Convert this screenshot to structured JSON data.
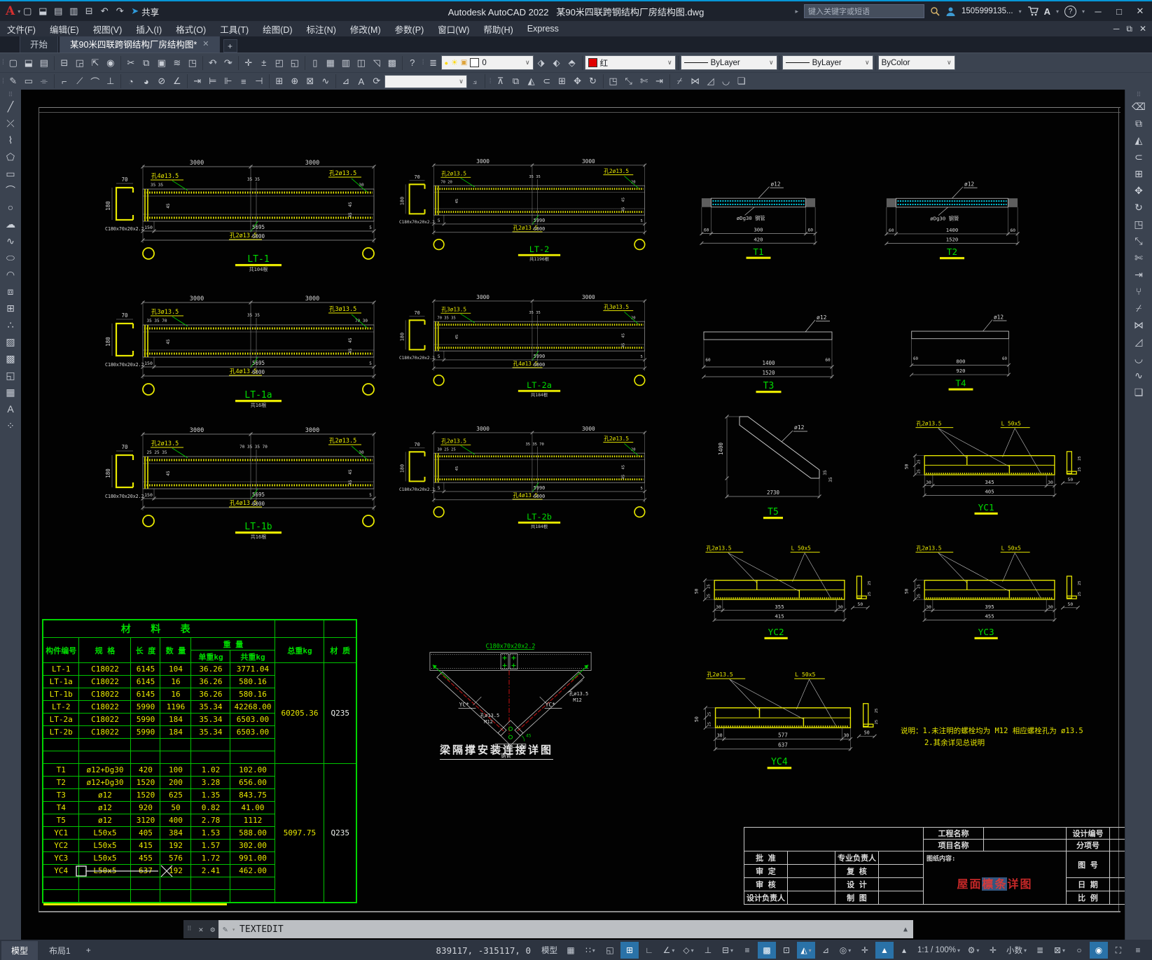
{
  "window": {
    "logo": "A",
    "app_title": "Autodesk AutoCAD 2022",
    "doc_title": "某90米四联跨钢结构厂房结构图.dwg",
    "share": "共享",
    "search_placeholder": "键入关键字或短语",
    "user": "1505999135..."
  },
  "menu": [
    "文件(F)",
    "编辑(E)",
    "视图(V)",
    "插入(I)",
    "格式(O)",
    "工具(T)",
    "绘图(D)",
    "标注(N)",
    "修改(M)",
    "参数(P)",
    "窗口(W)",
    "帮助(H)",
    "Express"
  ],
  "tabs": {
    "start": "开始",
    "document": "某90米四联跨钢结构厂房结构图*"
  },
  "controls": {
    "layer_value": "0",
    "color_value": "红",
    "linetype_value": "ByLayer",
    "lineweight_value": "ByLayer",
    "plotstyle_value": "ByColor"
  },
  "command": {
    "label": "TEXTEDIT"
  },
  "layout_tabs": {
    "model": "模型",
    "layout1": "布局1"
  },
  "statusbar": {
    "coords": "839117, -315117, 0",
    "model_space": "模型",
    "scale": "1:1 / 100%",
    "units": "小数"
  },
  "colors": {
    "accent_blue": "#0696d7",
    "cad_yellow": "#e8e800",
    "cad_green": "#00d800",
    "cad_cyan": "#00e5ff",
    "cad_red": "#cc2222",
    "table_green": "#00c400"
  },
  "qat_icons": [
    {
      "n": "new-file-icon",
      "g": "▢"
    },
    {
      "n": "open-file-icon",
      "g": "⬓"
    },
    {
      "n": "save-icon",
      "g": "▤"
    },
    {
      "n": "save-as-icon",
      "g": "▥"
    },
    {
      "n": "plot-icon",
      "g": "⊟"
    },
    {
      "n": "undo-icon",
      "g": "↶"
    },
    {
      "n": "redo-icon",
      "g": "↷"
    }
  ],
  "std_toolbar": [
    {
      "n": "new-icon",
      "g": "▢"
    },
    {
      "n": "open-icon",
      "g": "⬓"
    },
    {
      "n": "save-icon",
      "g": "▤"
    },
    {
      "n": "sep"
    },
    {
      "n": "plot-icon",
      "g": "⊟"
    },
    {
      "n": "plot-preview-icon",
      "g": "◲"
    },
    {
      "n": "publish-icon",
      "g": "⇱"
    },
    {
      "n": "batch-plot-icon",
      "g": "◉"
    },
    {
      "n": "sep"
    },
    {
      "n": "cut-icon",
      "g": "✂"
    },
    {
      "n": "copy-clip-icon",
      "g": "⧉"
    },
    {
      "n": "paste-icon",
      "g": "▣"
    },
    {
      "n": "match-properties-icon",
      "g": "≋"
    },
    {
      "n": "block-editor-icon",
      "g": "◳"
    },
    {
      "n": "sep"
    },
    {
      "n": "undo-icon",
      "g": "↶",
      "c": 1
    },
    {
      "n": "redo-icon",
      "g": "↷",
      "c": 1
    },
    {
      "n": "sep"
    },
    {
      "n": "pan-icon",
      "g": "✛"
    },
    {
      "n": "zoom-realtime-icon",
      "g": "±"
    },
    {
      "n": "zoom-window-icon",
      "g": "◰"
    },
    {
      "n": "zoom-previous-icon",
      "g": "◱"
    },
    {
      "n": "sep"
    },
    {
      "n": "properties-icon",
      "g": "▯"
    },
    {
      "n": "designcenter-icon",
      "g": "▦"
    },
    {
      "n": "toolpalettes-icon",
      "g": "▥"
    },
    {
      "n": "sheetset-icon",
      "g": "◫"
    },
    {
      "n": "markup-icon",
      "g": "◹"
    },
    {
      "n": "qcalc-icon",
      "g": "▩"
    },
    {
      "n": "sep"
    },
    {
      "n": "help-icon",
      "g": "?"
    }
  ],
  "layer_toolbar": {
    "props_icon": "≣",
    "bulb": "●",
    "sun": "☀",
    "lock": "▣",
    "swatch": "□"
  },
  "layer_states": [
    {
      "n": "layer-previous-icon",
      "g": "⬗"
    },
    {
      "n": "layer-state-icon",
      "g": "⬖"
    },
    {
      "n": "layer-isolate-icon",
      "g": "⬘"
    }
  ],
  "dim_toolbar": [
    {
      "n": "textedit-icon",
      "g": "✎"
    },
    {
      "n": "mtext-edit-icon",
      "g": "▭"
    },
    {
      "n": "spellcheck-icon",
      "g": "⌯"
    },
    {
      "n": "sep"
    },
    {
      "n": "linear-dimension-icon",
      "g": "⌐"
    },
    {
      "n": "aligned-dimension-icon",
      "g": "⟋"
    },
    {
      "n": "arc-length-icon",
      "g": "⌒"
    },
    {
      "n": "ordinate-icon",
      "g": "⊥"
    },
    {
      "n": "sep"
    },
    {
      "n": "radius-icon",
      "g": "◔"
    },
    {
      "n": "jogged-icon",
      "g": "◕"
    },
    {
      "n": "diameter-icon",
      "g": "⊘"
    },
    {
      "n": "angular-icon",
      "g": "∠"
    },
    {
      "n": "sep"
    },
    {
      "n": "quick-dim-icon",
      "g": "⇥"
    },
    {
      "n": "baseline-icon",
      "g": "⊨"
    },
    {
      "n": "continue-icon",
      "g": "⊩"
    },
    {
      "n": "dim-space-icon",
      "g": "≡"
    },
    {
      "n": "dim-break-icon",
      "g": "⊣"
    },
    {
      "n": "sep"
    },
    {
      "n": "tolerance-icon",
      "g": "⊞"
    },
    {
      "n": "center-mark-icon",
      "g": "⊕"
    },
    {
      "n": "inspect-icon",
      "g": "⊠"
    },
    {
      "n": "jog-line-icon",
      "g": "∿"
    },
    {
      "n": "sep"
    },
    {
      "n": "dim-edit-icon",
      "g": "⊿"
    },
    {
      "n": "dim-text-edit-icon",
      "g": "A"
    },
    {
      "n": "dim-update-icon",
      "g": "⟳"
    }
  ],
  "modify2_toolbar": [
    {
      "n": "draworder-icon",
      "g": "⊼"
    },
    {
      "n": "copy-icon",
      "g": "⧉"
    },
    {
      "n": "mirror-icon",
      "g": "◭"
    },
    {
      "n": "offset-icon",
      "g": "⊂"
    },
    {
      "n": "array-icon",
      "g": "⊞"
    },
    {
      "n": "move-icon",
      "g": "✥"
    },
    {
      "n": "rotate-icon",
      "g": "↻"
    },
    {
      "n": "sep"
    },
    {
      "n": "scale-icon",
      "g": "◳"
    },
    {
      "n": "stretch-icon",
      "g": "⤡"
    },
    {
      "n": "trim-icon",
      "g": "✄"
    },
    {
      "n": "extend-icon",
      "g": "⇥"
    },
    {
      "n": "sep"
    },
    {
      "n": "break-icon",
      "g": "⌿"
    },
    {
      "n": "join-icon",
      "g": "⋈"
    },
    {
      "n": "chamfer-icon",
      "g": "◿"
    },
    {
      "n": "fillet-icon",
      "g": "◡"
    },
    {
      "n": "explode-icon",
      "g": "❏"
    }
  ],
  "draw_toolbar": [
    {
      "n": "line-icon",
      "g": "╱"
    },
    {
      "n": "xline-icon",
      "g": "⤫"
    },
    {
      "n": "polyline-icon",
      "g": "⌇"
    },
    {
      "n": "polygon-icon",
      "g": "⬠"
    },
    {
      "n": "rectangle-icon",
      "g": "▭"
    },
    {
      "n": "arc-icon",
      "g": "⌒"
    },
    {
      "n": "circle-icon",
      "g": "○"
    },
    {
      "n": "revcloud-icon",
      "g": "☁"
    },
    {
      "n": "spline-icon",
      "g": "∿"
    },
    {
      "n": "ellipse-icon",
      "g": "⬭"
    },
    {
      "n": "ellipse-arc-icon",
      "g": "◠"
    },
    {
      "n": "insert-block-icon",
      "g": "⧈"
    },
    {
      "n": "make-block-icon",
      "g": "⊞"
    },
    {
      "n": "point-icon",
      "g": "∴"
    },
    {
      "n": "hatch-icon",
      "g": "▨"
    },
    {
      "n": "gradient-icon",
      "g": "▩"
    },
    {
      "n": "region-icon",
      "g": "◱"
    },
    {
      "n": "table-icon",
      "g": "▦"
    },
    {
      "n": "mtext-icon",
      "g": "A"
    },
    {
      "n": "point-style-icon",
      "g": "⁘"
    }
  ],
  "modify_toolbar": [
    {
      "n": "erase-icon",
      "g": "⌫"
    },
    {
      "n": "copy-icon",
      "g": "⧉"
    },
    {
      "n": "mirror-icon",
      "g": "◭"
    },
    {
      "n": "offset-icon",
      "g": "⊂"
    },
    {
      "n": "array-icon",
      "g": "⊞"
    },
    {
      "n": "move-icon",
      "g": "✥"
    },
    {
      "n": "rotate-icon",
      "g": "↻"
    },
    {
      "n": "scale-icon",
      "g": "◳"
    },
    {
      "n": "stretch-icon",
      "g": "⤡"
    },
    {
      "n": "trim-icon",
      "g": "✄"
    },
    {
      "n": "extend-icon",
      "g": "⇥"
    },
    {
      "n": "break-at-point-icon",
      "g": "⑂"
    },
    {
      "n": "break-icon",
      "g": "⌿"
    },
    {
      "n": "join-icon",
      "g": "⋈"
    },
    {
      "n": "chamfer-icon",
      "g": "◿"
    },
    {
      "n": "fillet-icon",
      "g": "◡"
    },
    {
      "n": "blend-icon",
      "g": "∿"
    },
    {
      "n": "explode-icon",
      "g": "❏"
    }
  ],
  "status_items": [
    {
      "n": "grid",
      "g": "▦"
    },
    {
      "n": "snap-mode",
      "g": "∷",
      "c": 1
    },
    {
      "n": "infer-constraints",
      "g": "◱"
    },
    {
      "n": "dynamic-input",
      "g": "⊞",
      "a": 1
    },
    {
      "n": "ortho-mode",
      "g": "∟"
    },
    {
      "n": "polar-tracking",
      "g": "∠",
      "c": 1
    },
    {
      "n": "isometric-drafting",
      "g": "◇",
      "c": 1
    },
    {
      "n": "osnap-tracking",
      "g": "⊥"
    },
    {
      "n": "object-snap",
      "g": "⊟",
      "c": 1
    },
    {
      "n": "lineweight-display",
      "g": "≡"
    },
    {
      "n": "transparency",
      "g": "▩",
      "a": 1
    },
    {
      "n": "selection-cycling",
      "g": "⊡"
    },
    {
      "n": "osnap-3d",
      "g": "◭",
      "a": 1,
      "c": 1
    },
    {
      "n": "dynamic-ucs",
      "g": "⊿"
    },
    {
      "n": "selection-filtering",
      "g": "◎",
      "c": 1
    },
    {
      "n": "gizmo",
      "g": "✛"
    },
    {
      "n": "annotation-visibility",
      "g": "▲",
      "a": 1
    },
    {
      "n": "autoscale",
      "g": "▴"
    },
    {
      "n": "annotation-scale",
      "t": "1:1 / 100%",
      "c": 1
    },
    {
      "n": "workspace-switching",
      "g": "⚙",
      "c": 1
    },
    {
      "n": "annotation-monitor",
      "g": "✛"
    },
    {
      "n": "units",
      "t": "小数",
      "c": 1
    },
    {
      "n": "quick-properties",
      "g": "≣"
    },
    {
      "n": "lock-ui",
      "g": "⊠",
      "c": 1
    },
    {
      "n": "isolate-objects",
      "g": "○"
    },
    {
      "n": "graphics-performance",
      "g": "◉",
      "a": 1
    },
    {
      "n": "clean-screen",
      "g": "⛶"
    },
    {
      "n": "customization",
      "g": "≡"
    }
  ],
  "beams": [
    {
      "id": "LT-1",
      "count": "共104根",
      "dims_top": [
        "3000",
        "3000"
      ],
      "section": "C180x70x20x2.2",
      "sec_w": "70",
      "sec_h": "180",
      "hole_tl": "孔4ø13.5",
      "hole_bm": "孔2ø13.5",
      "hole_tr": "孔2ø13.5",
      "left_small": "35 35",
      "mid_small": "35 35",
      "right_small": "30",
      "dims_bottom": [
        "150",
        "5695",
        "5"
      ],
      "dim_total": "6000"
    },
    {
      "id": "LT-2",
      "count": "共1196根",
      "dims_top": [
        "3000",
        "3000"
      ],
      "section": "C180x70x20x2.2",
      "sec_w": "70",
      "sec_h": "180",
      "hole_tl": "孔2ø13.5",
      "hole_bm": "孔2ø13.5",
      "hole_tr": "孔2ø13.5",
      "left_small": "70 20",
      "mid_small": "35 35",
      "right_small": "20",
      "dims_bottom": [
        "5",
        "5990",
        "5"
      ],
      "dim_total": "6000"
    },
    {
      "id": "LT-1a",
      "count": "共16根",
      "dims_top": [
        "3000",
        "3000"
      ],
      "section": "C180x70x20x2.2",
      "sec_w": "70",
      "sec_h": "180",
      "hole_tl": "孔3ø13.5",
      "hole_bm": "孔4ø13.5",
      "hole_tr": "孔3ø13.5",
      "left_small": "35 35 70",
      "mid_small": "35 35",
      "right_small": "70 30",
      "dims_bottom": [
        "150",
        "5695",
        "5"
      ],
      "dim_total": "6000"
    },
    {
      "id": "LT-2a",
      "count": "共184根",
      "dims_top": [
        "3000",
        "3000"
      ],
      "section": "C180x70x20x2.2",
      "sec_w": "70",
      "sec_h": "180",
      "hole_tl": "孔3ø13.5",
      "hole_bm": "孔4ø13.5",
      "hole_tr": "孔3ø13.5",
      "left_small": "70 35 35",
      "mid_small": "35 35",
      "right_small": "20",
      "dims_bottom": [
        "5",
        "5990",
        "5"
      ],
      "dim_total": "6000"
    },
    {
      "id": "LT-1b",
      "count": "共16根",
      "dims_top": [
        "3000",
        "3000"
      ],
      "section": "C180x70x20x2.2",
      "sec_w": "70",
      "sec_h": "180",
      "hole_tl": "孔2ø13.5",
      "hole_bm": "孔4ø13.5",
      "hole_tr": "孔2ø13.5",
      "left_small": "25 25 35",
      "mid_small": "70 35 35 70",
      "right_small": "30",
      "dims_bottom": [
        "150",
        "5695",
        "5"
      ],
      "dim_total": "6000"
    },
    {
      "id": "LT-2b",
      "count": "共184根",
      "dims_top": [
        "3000",
        "3000"
      ],
      "section": "C180x70x20x2.2",
      "sec_w": "70",
      "sec_h": "180",
      "hole_tl": "孔2ø13.5",
      "hole_bm": "孔4ø13.5",
      "hole_tr": "孔2ø13.5",
      "left_small": "30 25 25",
      "mid_small": "35 35 70",
      "right_small": "20",
      "dims_bottom": [
        "5",
        "5990",
        "5"
      ],
      "dim_total": "6000"
    }
  ],
  "ties": [
    {
      "id": "T1",
      "type": "pipe",
      "rod": "ø12",
      "pipe": "øDg30 钢管",
      "sides": [
        "60",
        "60"
      ],
      "mid": "300",
      "total": "420"
    },
    {
      "id": "T2",
      "type": "pipe",
      "rod": "ø12",
      "pipe": "øDg30 钢管",
      "sides": [
        "60",
        "60"
      ],
      "mid": "1400",
      "total": "1520"
    },
    {
      "id": "T3",
      "type": "bar",
      "rod": "ø12",
      "sides": [
        "60",
        "60"
      ],
      "mid": "1400",
      "total": "1520"
    },
    {
      "id": "T4",
      "type": "bar",
      "rod": "ø12",
      "sides": [
        "60",
        "60"
      ],
      "mid": "800",
      "total": "920"
    },
    {
      "id": "T5",
      "type": "zbar",
      "rod": "ø12",
      "dim_h": "2730",
      "dim_v": "1400",
      "small": "35"
    }
  ],
  "ycs": [
    {
      "id": "YC1",
      "hole": "孔2ø13.5",
      "angle": "L 50x5",
      "d": [
        "30",
        "345",
        "30"
      ],
      "total": "405",
      "side": "50",
      "side_sub": [
        "25",
        "25"
      ],
      "tab": "50"
    },
    {
      "id": "YC2",
      "hole": "孔2ø13.5",
      "angle": "L 50x5",
      "d": [
        "30",
        "355",
        "30"
      ],
      "total": "415",
      "side": "50",
      "side_sub": [
        "25",
        "25"
      ],
      "tab": "50"
    },
    {
      "id": "YC3",
      "hole": "孔2ø13.5",
      "angle": "L 50x5",
      "d": [
        "30",
        "395",
        "30"
      ],
      "total": "455",
      "side": "50",
      "side_sub": [
        "25",
        "25"
      ],
      "tab": "50"
    },
    {
      "id": "YC4",
      "hole": "孔2ø13.5",
      "angle": "L 50x5",
      "d": [
        "30",
        "577",
        "30"
      ],
      "total": "637",
      "side": "50",
      "side_sub": [
        "25",
        "25"
      ],
      "tab": "50"
    }
  ],
  "brace_detail": {
    "section": "C180x70x20x2.2",
    "member_left": "YC*",
    "member_right": "YC*",
    "bolt": "孔ø13.5",
    "bolt2": "M12",
    "pipe": "钢管",
    "angle": "45",
    "caption": "梁隔撑安装连接详图"
  },
  "notes": [
    "说明：1.未注明的螺栓均为 M12 相应螺栓孔为 ø13.5",
    "2.其余详见总说明"
  ],
  "material_table": {
    "title": "材 料 表",
    "headers": {
      "member": "构件编号",
      "spec": "规 格",
      "length": "长 度",
      "qty": "数 量",
      "weight": "重  量",
      "unit_w": "单重kg",
      "total_w": "共重kg",
      "grand": "总重kg",
      "grade": "材 质"
    },
    "rows": [
      [
        "LT-1",
        "C18022",
        "6145",
        "104",
        "36.26",
        "3771.04"
      ],
      [
        "LT-1a",
        "C18022",
        "6145",
        "16",
        "36.26",
        "580.16"
      ],
      [
        "LT-1b",
        "C18022",
        "6145",
        "16",
        "36.26",
        "580.16"
      ],
      [
        "LT-2",
        "C18022",
        "5990",
        "1196",
        "35.34",
        "42268.00"
      ],
      [
        "LT-2a",
        "C18022",
        "5990",
        "184",
        "35.34",
        "6503.00"
      ],
      [
        "LT-2b",
        "C18022",
        "5990",
        "184",
        "35.34",
        "6503.00"
      ],
      [
        "",
        "",
        "",
        "",
        "",
        ""
      ],
      [
        "",
        "",
        "",
        "",
        "",
        ""
      ],
      [
        "T1",
        "ø12+Dg30",
        "420",
        "100",
        "1.02",
        "102.00"
      ],
      [
        "T2",
        "ø12+Dg30",
        "1520",
        "200",
        "3.28",
        "656.00"
      ],
      [
        "T3",
        "ø12",
        "1520",
        "625",
        "1.35",
        "843.75"
      ],
      [
        "T4",
        "ø12",
        "920",
        "50",
        "0.82",
        "41.00"
      ],
      [
        "T5",
        "ø12",
        "3120",
        "400",
        "2.78",
        "1112"
      ],
      [
        "YC1",
        "L50x5",
        "405",
        "384",
        "1.53",
        "588.00"
      ],
      [
        "YC2",
        "L50x5",
        "415",
        "192",
        "1.57",
        "302.00"
      ],
      [
        "YC3",
        "L50x5",
        "455",
        "576",
        "1.72",
        "991.00"
      ],
      [
        "YC4",
        "L50x5",
        "637",
        "192",
        "2.41",
        "462.00"
      ],
      [
        "",
        "",
        "",
        "",
        "",
        ""
      ],
      [
        "",
        "",
        "",
        "",
        "",
        ""
      ]
    ],
    "groups": [
      {
        "span": 8,
        "total": "60205.36",
        "grade": "Q235"
      },
      {
        "span": 11,
        "total": "5097.75",
        "grade": "Q235"
      }
    ]
  },
  "title_block": {
    "left_rows": [
      "批  准",
      "审  定",
      "审  核",
      "设计负责人"
    ],
    "mid_rows": [
      "专业负责人",
      "复  核",
      "设  计",
      "制  图"
    ],
    "top_rows": [
      "工程名称",
      "项目名称"
    ],
    "right_rows": [
      "设计编号",
      "分项号",
      "图  号",
      "日  期",
      "比  例"
    ],
    "content_label": "图纸内容:",
    "content_pre": "屋面",
    "content_hl": "檩条",
    "content_post": "详图"
  }
}
